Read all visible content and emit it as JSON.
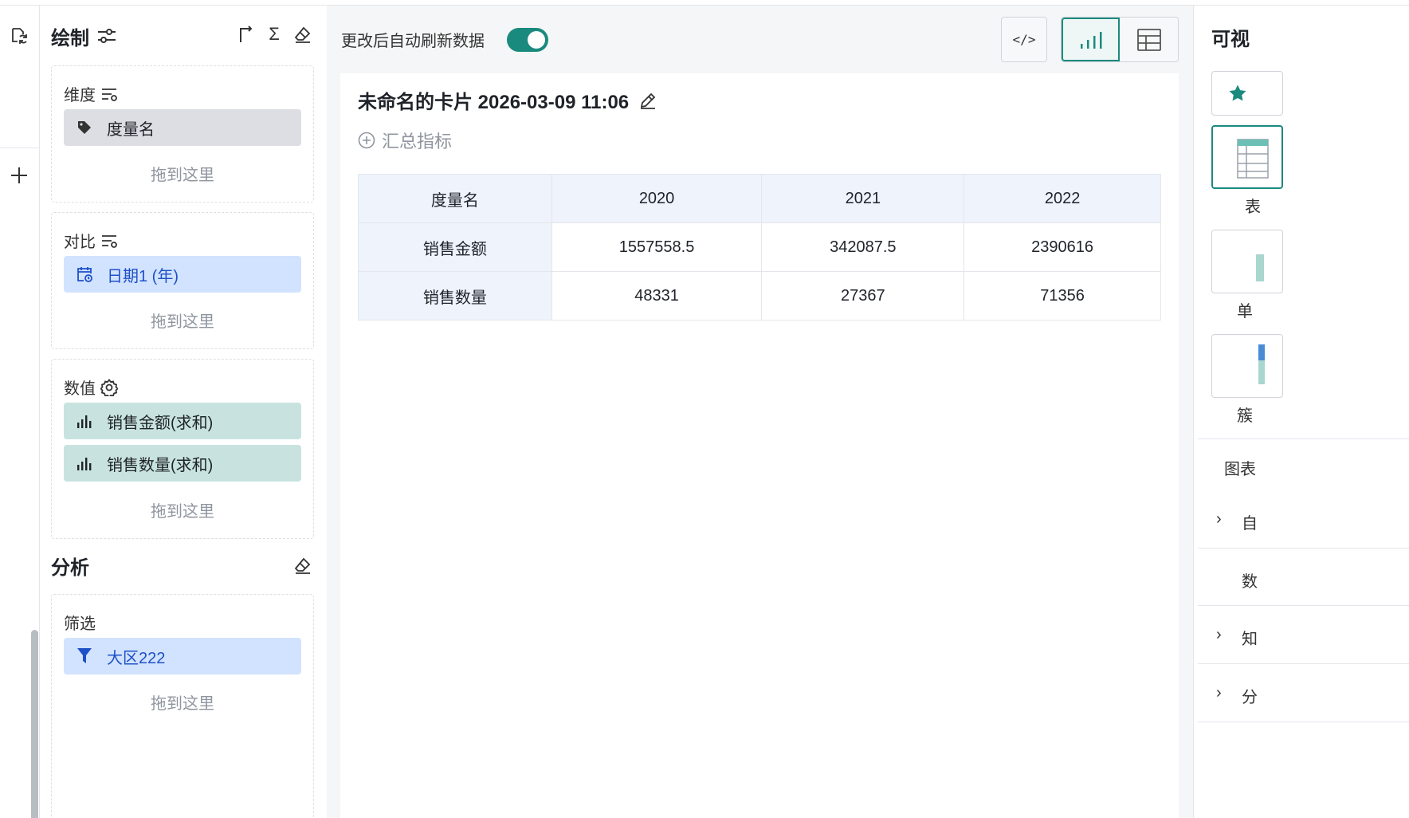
{
  "panel": {
    "title": "绘制",
    "dimension": {
      "label": "维度",
      "field": "度量名",
      "drop": "拖到这里"
    },
    "compare": {
      "label": "对比",
      "field": "日期1 (年)",
      "drop": "拖到这里"
    },
    "values": {
      "label": "数值",
      "fields": [
        "销售金额(求和)",
        "销售数量(求和)"
      ],
      "drop": "拖到这里"
    },
    "analysis": {
      "title": "分析"
    },
    "filter": {
      "label": "筛选",
      "field": "大区222",
      "drop": "拖到这里"
    }
  },
  "center": {
    "auto_refresh_label": "更改后自动刷新数据",
    "auto_refresh_on": true,
    "card_title": "未命名的卡片 2026-03-09 11:06",
    "add_metric": "汇总指标",
    "table": {
      "headers": [
        "度量名",
        "2020",
        "2021",
        "2022"
      ],
      "rows": [
        [
          "销售金额",
          "1557558.5",
          "342087.5",
          "2390616"
        ],
        [
          "销售数量",
          "48331",
          "27367",
          "71356"
        ]
      ]
    }
  },
  "right": {
    "title": "可视",
    "label_1": "表",
    "label_2": "单",
    "label_3": "簇",
    "label_4": "图表",
    "label_5": "自",
    "label_6": "数",
    "label_7": "知",
    "label_8": "分"
  },
  "colors": {
    "accent": "#1b8a7e",
    "dimension_pill": "#dcdee3",
    "compare_pill": "#d2e3ff",
    "value_pill": "#c8e3df",
    "table_header": "#eef3fc"
  }
}
